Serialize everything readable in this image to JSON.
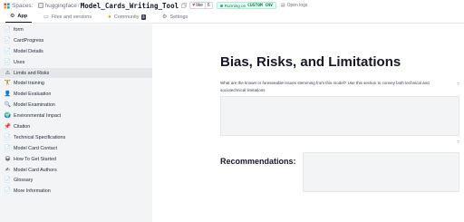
{
  "header": {
    "spaces_label": "Spaces:",
    "owner": "huggingface",
    "separator": "/",
    "repo_name": "Model_Cards_Writing_Tool",
    "like_label": "like",
    "like_count": "6",
    "status_text": "Running on",
    "status_hardware": "CUSTOM CNV",
    "logs_label": "Open logs"
  },
  "tabs": [
    {
      "label": "App",
      "icon": "gear-icon",
      "active": true
    },
    {
      "label": "Files and versions",
      "icon": "files-icon",
      "active": false
    },
    {
      "label": "Community",
      "icon": "community-icon",
      "badge": "3",
      "active": false
    },
    {
      "label": "Settings",
      "icon": "settings-icon",
      "active": false
    }
  ],
  "sidebar": {
    "items": [
      {
        "icon": "📄",
        "icon_name": "page-icon",
        "label": "form"
      },
      {
        "icon": "📄",
        "icon_name": "page-icon",
        "label": "CardProgress"
      },
      {
        "icon": "📄",
        "icon_name": "page-icon",
        "label": "Model Details"
      },
      {
        "icon": "📄",
        "icon_name": "page-icon",
        "label": "Uses"
      },
      {
        "icon": "⚠",
        "icon_name": "warning-icon",
        "label": "Limits and Risks"
      },
      {
        "icon": "🏋",
        "icon_name": "weightlifter-icon",
        "label": "Model training"
      },
      {
        "icon": "👤",
        "icon_name": "person-icon",
        "label": "Model Evaluation"
      },
      {
        "icon": "🔍",
        "icon_name": "magnifier-icon",
        "label": "Model Examination"
      },
      {
        "icon": "🌍",
        "icon_name": "globe-icon",
        "label": "Environmental Impact"
      },
      {
        "icon": "📌",
        "icon_name": "pin-icon",
        "label": "Citation"
      },
      {
        "icon": "📄",
        "icon_name": "page-icon",
        "label": "Technical Specifications"
      },
      {
        "icon": "📄",
        "icon_name": "page-icon",
        "label": "Model Card Contact"
      },
      {
        "icon": "😀",
        "icon_name": "smiley-icon",
        "label": "How To Get Started"
      },
      {
        "icon": "✍",
        "icon_name": "writing-hand-icon",
        "label": "Model Card Authors"
      },
      {
        "icon": "📄",
        "icon_name": "page-icon",
        "label": "Glossary"
      },
      {
        "icon": "📄",
        "icon_name": "page-icon",
        "label": "More Information"
      }
    ],
    "active_index": 4
  },
  "main": {
    "title": "Bias, Risks, and Limitations",
    "description": "What are the known or foreseeable issues stemming from this model? Use this section to convey both technical and sociotechnical limitations",
    "help_icon": "?",
    "recommendations_label": "Recommendations:"
  },
  "colors": {
    "sidebar_bg": "#f3f4f6",
    "active_item_bg": "#e5e7eb",
    "running_green": "#10b981",
    "heart_red": "#ef4444"
  }
}
